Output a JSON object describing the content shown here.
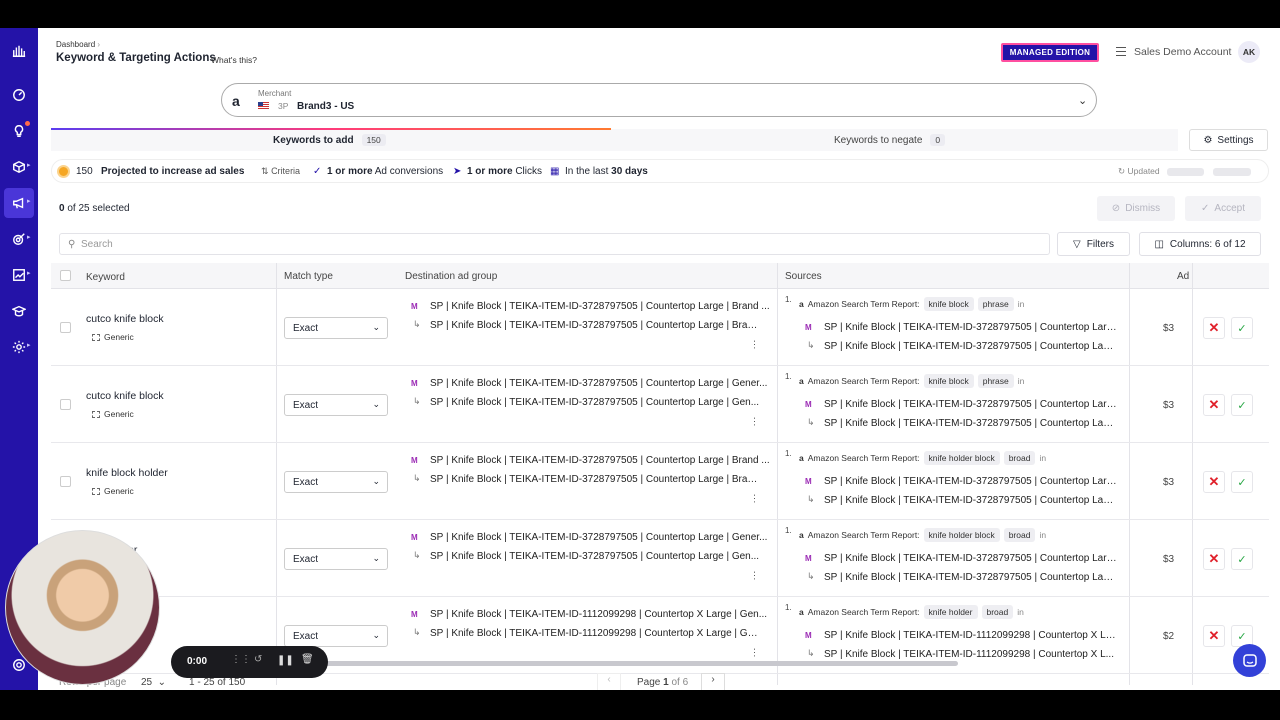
{
  "header": {
    "breadcrumb": "Dashboard",
    "title": "Keyword & Targeting Actions",
    "whats_this": "What's this?",
    "managed": "MANAGED EDITION",
    "account": "Sales Demo Account",
    "avatar": "AK"
  },
  "merchant": {
    "label": "Merchant",
    "type": "3P",
    "name": "Brand3 - US"
  },
  "tabs": [
    {
      "label": "Keywords to add",
      "count": "150"
    },
    {
      "label": "Keywords to negate",
      "count": "0"
    }
  ],
  "settings_label": "Settings",
  "infobar": {
    "count": "150",
    "projected": "Projected to increase ad sales",
    "criteria": "Criteria",
    "c1_bold": "1 or more",
    "c1": "Ad conversions",
    "c2_bold": "1 or more",
    "c2": "Clicks",
    "c3": "In the last",
    "c3_bold": "30 days",
    "updated": "Updated"
  },
  "selection": {
    "count": "0",
    "suffix": "of 25 selected"
  },
  "actions": {
    "dismiss": "Dismiss",
    "accept": "Accept",
    "filters": "Filters",
    "columns": "Columns: 6 of 12"
  },
  "search_placeholder": "Search",
  "columns": [
    "Keyword",
    "Match type",
    "Destination ad group",
    "Sources",
    "Ad"
  ],
  "rows": [
    {
      "keyword": "cutco knife block",
      "tag": "Generic",
      "match": "Exact",
      "dag1": "SP | Knife Block | TEIKA-ITEM-ID-3728797505 | Countertop Large | Brand ...",
      "dag2": "SP | Knife Block | TEIKA-ITEM-ID-3728797505 | Countertop Large | Bran...",
      "src_n": "1.",
      "src_report": "Amazon Search Term Report:",
      "src_term": "knife block",
      "src_type": "phrase",
      "src_in": "in",
      "s1": "SP | Knife Block | TEIKA-ITEM-ID-3728797505 | Countertop Larg...",
      "s2": "SP | Knife Block | TEIKA-ITEM-ID-3728797505 | Countertop Lar...",
      "ad": "$3"
    },
    {
      "keyword": "cutco knife block",
      "tag": "Generic",
      "match": "Exact",
      "dag1": "SP | Knife Block | TEIKA-ITEM-ID-3728797505 | Countertop Large | Gener...",
      "dag2": "SP | Knife Block | TEIKA-ITEM-ID-3728797505 | Countertop Large | Gen...",
      "src_n": "1.",
      "src_report": "Amazon Search Term Report:",
      "src_term": "knife block",
      "src_type": "phrase",
      "src_in": "in",
      "s1": "SP | Knife Block | TEIKA-ITEM-ID-3728797505 | Countertop Larg...",
      "s2": "SP | Knife Block | TEIKA-ITEM-ID-3728797505 | Countertop Lar...",
      "ad": "$3"
    },
    {
      "keyword": "knife block holder",
      "tag": "Generic",
      "match": "Exact",
      "dag1": "SP | Knife Block | TEIKA-ITEM-ID-3728797505 | Countertop Large | Brand ...",
      "dag2": "SP | Knife Block | TEIKA-ITEM-ID-3728797505 | Countertop Large | Bran...",
      "src_n": "1.",
      "src_report": "Amazon Search Term Report:",
      "src_term": "knife holder block",
      "src_type": "broad",
      "src_in": "in",
      "s1": "SP | Knife Block | TEIKA-ITEM-ID-3728797505 | Countertop Larg...",
      "s2": "SP | Knife Block | TEIKA-ITEM-ID-3728797505 | Countertop Lar...",
      "ad": "$3"
    },
    {
      "keyword": "...ck holder",
      "tag": "",
      "match": "Exact",
      "dag1": "SP | Knife Block | TEIKA-ITEM-ID-3728797505 | Countertop Large | Gener...",
      "dag2": "SP | Knife Block | TEIKA-ITEM-ID-3728797505 | Countertop Large | Gen...",
      "src_n": "1.",
      "src_report": "Amazon Search Term Report:",
      "src_term": "knife holder block",
      "src_type": "broad",
      "src_in": "in",
      "s1": "SP | Knife Block | TEIKA-ITEM-ID-3728797505 | Countertop Larg...",
      "s2": "SP | Knife Block | TEIKA-ITEM-ID-3728797505 | Countertop Lar...",
      "ad": "$3"
    },
    {
      "keyword": "...lder",
      "tag": "",
      "match": "Exact",
      "dag1": "SP | Knife Block | TEIKA-ITEM-ID-1112099298 | Countertop X Large | Gen...",
      "dag2": "SP | Knife Block | TEIKA-ITEM-ID-1112099298 | Countertop X Large | Ge...",
      "src_n": "1.",
      "src_report": "Amazon Search Term Report:",
      "src_term": "knife holder",
      "src_type": "broad",
      "src_in": "in",
      "s1": "SP | Knife Block | TEIKA-ITEM-ID-1112099298 | Countertop X Lar...",
      "s2": "SP | Knife Block | TEIKA-ITEM-ID-1112099298 | Countertop X L...",
      "ad": "$2"
    }
  ],
  "footer": {
    "rows_label": "Rows per page",
    "rows": "25",
    "range": "1 - 25",
    "of": "of",
    "total": "150",
    "page_label": "Page",
    "page": "1",
    "of_pages": "of 6"
  },
  "recorder": {
    "time": "0:00"
  }
}
